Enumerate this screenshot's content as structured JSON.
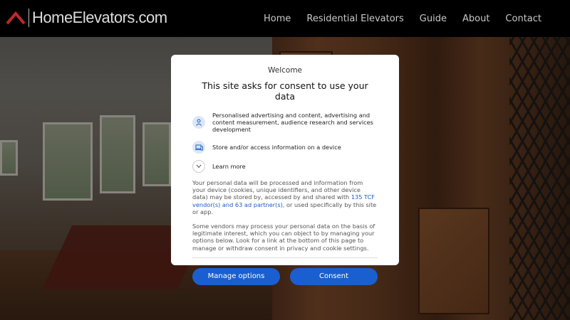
{
  "header": {
    "logo_text": "HomeElevators.com",
    "nav": [
      "Home",
      "Residential Elevators",
      "Guide",
      "About",
      "Contact"
    ]
  },
  "consent": {
    "welcome": "Welcome",
    "title": "This site asks for consent to use your data",
    "items": [
      {
        "icon": "person-icon",
        "text": "Personalised advertising and content, advertising and content measurement, audience research and services development"
      },
      {
        "icon": "device-icon",
        "text": "Store and/or access information on a device"
      },
      {
        "icon": "chevron-down-icon",
        "text": "Learn more"
      }
    ],
    "para1_before": "Your personal data will be processed and information from your device (cookies, unique identifiers, and other device data) may be stored by, accessed by and shared with ",
    "para1_link": "135 TCF vendor(s) and 63 ad partner(s)",
    "para1_after": ", or used specifically by this site or app.",
    "para2": "Some vendors may process your personal data on the basis of legitimate interest, which you can object to by managing your options below. Look for a link at the bottom of this page to manage or withdraw consent in privacy and cookie settings.",
    "manage_label": "Manage options",
    "consent_label": "Consent"
  },
  "colors": {
    "accent": "#1a5fcf",
    "logo_red": "#c0282a"
  }
}
